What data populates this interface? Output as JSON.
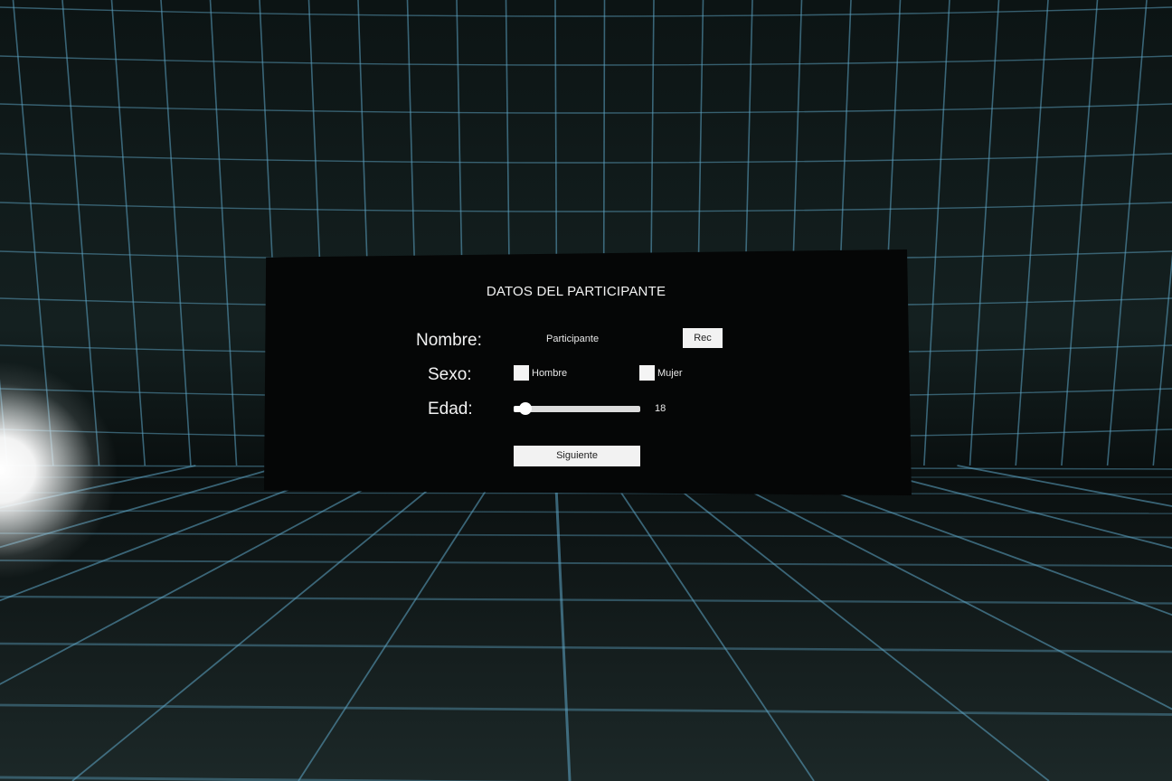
{
  "scene": {
    "grid_color": "#5fa8c8",
    "floor_color": "#1a2424",
    "wall_color": "#111a1a"
  },
  "form": {
    "title": "DATOS DEL PARTICIPANTE",
    "nombre_label": "Nombre:",
    "nombre_value": "Participante",
    "rec_button": "Rec",
    "sexo_label": "Sexo:",
    "sexo_options": [
      "Hombre",
      "Mujer"
    ],
    "edad_label": "Edad:",
    "edad_value": "18",
    "edad_slider_fraction": 0.05,
    "siguiente_button": "Siguiente"
  }
}
